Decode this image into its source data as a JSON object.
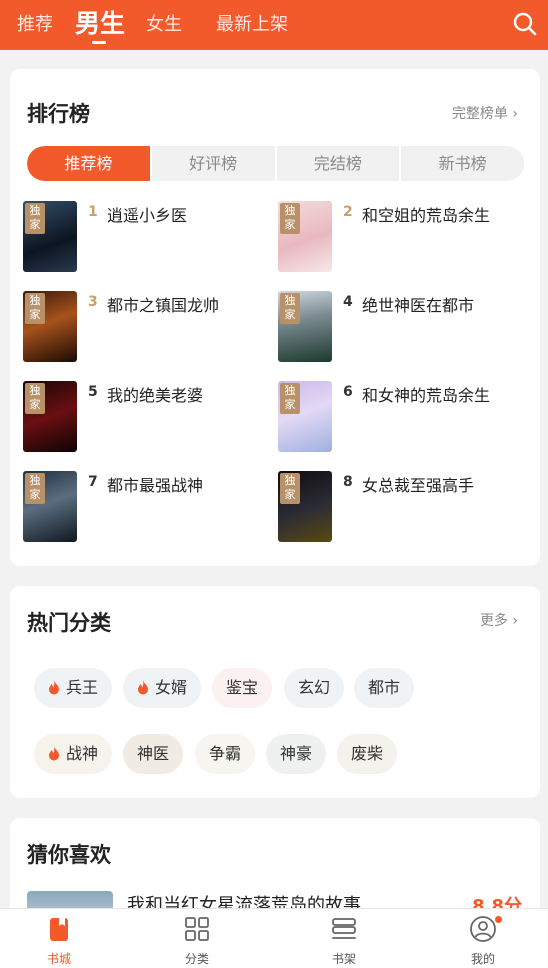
{
  "top_nav": {
    "tabs": [
      "推荐",
      "男生",
      "女生",
      "最新上架"
    ],
    "active_index": 1
  },
  "ranking": {
    "title": "排行榜",
    "more_label": "完整榜单 ›",
    "tabs": [
      "推荐榜",
      "好评榜",
      "完结榜",
      "新书榜"
    ],
    "active_tab": 0,
    "badge": "独家",
    "books": [
      {
        "rank": "1",
        "title": "逍遥小乡医"
      },
      {
        "rank": "2",
        "title": "和空姐的荒岛余生"
      },
      {
        "rank": "3",
        "title": "都市之镇国龙帅"
      },
      {
        "rank": "4",
        "title": "绝世神医在都市"
      },
      {
        "rank": "5",
        "title": "我的绝美老婆"
      },
      {
        "rank": "6",
        "title": "和女神的荒岛余生"
      },
      {
        "rank": "7",
        "title": "都市最强战神"
      },
      {
        "rank": "8",
        "title": "女总裁至强高手"
      }
    ]
  },
  "categories": {
    "title": "热门分类",
    "more_label": "更多 ›",
    "tags": [
      "兵王",
      "女婿",
      "鉴宝",
      "玄幻",
      "都市",
      "战神",
      "神医",
      "争霸",
      "神豪",
      "废柴"
    ]
  },
  "recommend": {
    "title": "猜你喜欢",
    "first_title": "我和当红女星流落荒岛的故事",
    "first_score": "8.8分"
  },
  "bottom_nav": {
    "items": [
      "书城",
      "分类",
      "书架",
      "我的"
    ],
    "active_index": 0
  },
  "colors": {
    "accent": "#f2592b",
    "badge": "#b99168",
    "rank_gold": "#c8a06a"
  }
}
